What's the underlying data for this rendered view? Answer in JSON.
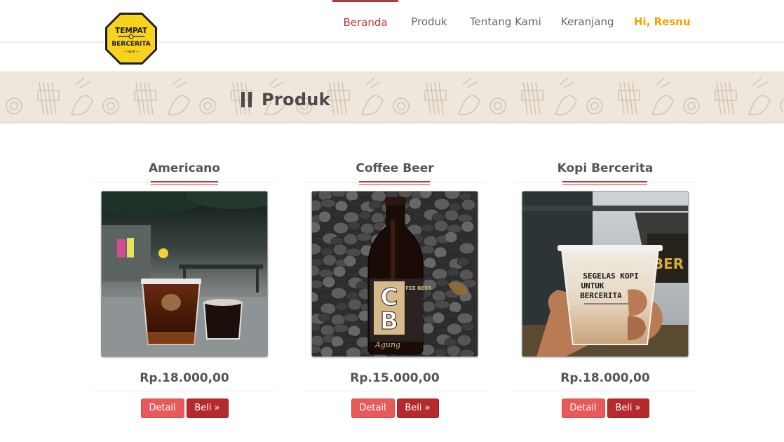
{
  "logo": {
    "line1": "TEMPAT",
    "line2": "BERCERITA",
    "small": "— SEJAK —"
  },
  "nav": {
    "items": [
      {
        "label": "Beranda",
        "active": true
      },
      {
        "label": "Produk"
      },
      {
        "label": "Tentang Kami"
      },
      {
        "label": "Keranjang"
      }
    ],
    "user_greeting": "Hi, Resnu"
  },
  "banner": {
    "title": "Produk",
    "icon": "pause-icon"
  },
  "products": [
    {
      "name": "Americano",
      "price": "Rp.18.000,00",
      "detail_label": "Detail",
      "buy_label": "Beli »",
      "image": "iced-americano-photo"
    },
    {
      "name": "Coffee Beer",
      "price": "Rp.15.000,00",
      "detail_label": "Detail",
      "buy_label": "Beli »",
      "image": "coffee-beer-bottle-photo",
      "bottle_label": {
        "initials_top": "C",
        "initials_bottom": "B",
        "side": "COFFEE BEER",
        "script": "Agung"
      }
    },
    {
      "name": "Kopi Bercerita",
      "price": "Rp.18.000,00",
      "detail_label": "Detail",
      "buy_label": "Beli »",
      "image": "kopi-bercerita-cup-photo",
      "cup_text": [
        "SEGELAS KOPI",
        "UNTUK",
        "BERCERITA"
      ]
    }
  ],
  "colors": {
    "accent": "#b23a3a",
    "user": "#f4a300",
    "detail_button": "#e8595a",
    "buy_button": "#b52a2c",
    "banner_bg": "#efe6dc"
  }
}
